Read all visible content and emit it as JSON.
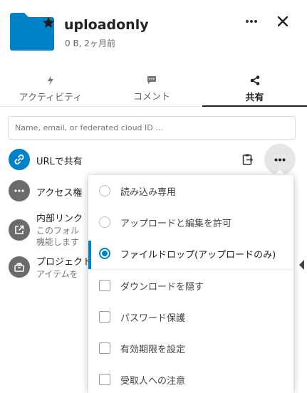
{
  "header": {
    "title": "uploadonly",
    "subtitle": "0 B, 2ヶ月前",
    "folder_color": "#0082c9"
  },
  "tabs": [
    {
      "label": "アクティビティ",
      "icon": "lightning-icon"
    },
    {
      "label": "コメント",
      "icon": "comment-icon"
    },
    {
      "label": "共有",
      "icon": "share-icon",
      "active": true
    }
  ],
  "search": {
    "placeholder": "Name, email, or federated cloud ID ..."
  },
  "shares": {
    "url_share": {
      "label": "URLで共有"
    },
    "access": {
      "label": "アクセス権"
    },
    "internal_link": {
      "label": "内部リンク",
      "sub1": "このフォル",
      "sub2": "機能します"
    },
    "project": {
      "label": "プロジェクト",
      "sub": "アイテムを"
    }
  },
  "menu": {
    "items": [
      {
        "label": "読み込み専用",
        "type": "radio",
        "checked": false
      },
      {
        "label": "アップロードと編集を許可",
        "type": "radio",
        "checked": false
      },
      {
        "label": "ファイルドロップ(アップロードのみ)",
        "type": "radio",
        "checked": true
      },
      {
        "label": "ダウンロードを隠す",
        "type": "checkbox",
        "checked": false
      },
      {
        "label": "パスワード保護",
        "type": "checkbox",
        "checked": false
      },
      {
        "label": "有効期限を設定",
        "type": "checkbox",
        "checked": false
      },
      {
        "label": "受取人への注意",
        "type": "checkbox",
        "checked": false
      }
    ]
  },
  "colors": {
    "accent": "#0082c9",
    "avatar_grey": "#6b6b6b"
  }
}
